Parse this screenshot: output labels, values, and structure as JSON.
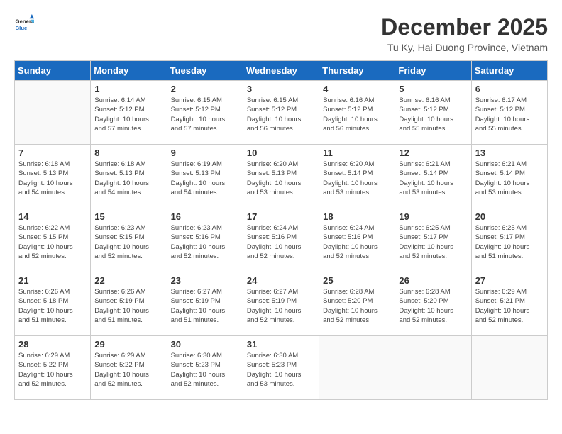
{
  "logo": {
    "line1": "General",
    "line2": "Blue"
  },
  "title": "December 2025",
  "subtitle": "Tu Ky, Hai Duong Province, Vietnam",
  "weekdays": [
    "Sunday",
    "Monday",
    "Tuesday",
    "Wednesday",
    "Thursday",
    "Friday",
    "Saturday"
  ],
  "weeks": [
    [
      {
        "day": "",
        "info": ""
      },
      {
        "day": "1",
        "info": "Sunrise: 6:14 AM\nSunset: 5:12 PM\nDaylight: 10 hours\nand 57 minutes."
      },
      {
        "day": "2",
        "info": "Sunrise: 6:15 AM\nSunset: 5:12 PM\nDaylight: 10 hours\nand 57 minutes."
      },
      {
        "day": "3",
        "info": "Sunrise: 6:15 AM\nSunset: 5:12 PM\nDaylight: 10 hours\nand 56 minutes."
      },
      {
        "day": "4",
        "info": "Sunrise: 6:16 AM\nSunset: 5:12 PM\nDaylight: 10 hours\nand 56 minutes."
      },
      {
        "day": "5",
        "info": "Sunrise: 6:16 AM\nSunset: 5:12 PM\nDaylight: 10 hours\nand 55 minutes."
      },
      {
        "day": "6",
        "info": "Sunrise: 6:17 AM\nSunset: 5:12 PM\nDaylight: 10 hours\nand 55 minutes."
      }
    ],
    [
      {
        "day": "7",
        "info": "Sunrise: 6:18 AM\nSunset: 5:13 PM\nDaylight: 10 hours\nand 54 minutes."
      },
      {
        "day": "8",
        "info": "Sunrise: 6:18 AM\nSunset: 5:13 PM\nDaylight: 10 hours\nand 54 minutes."
      },
      {
        "day": "9",
        "info": "Sunrise: 6:19 AM\nSunset: 5:13 PM\nDaylight: 10 hours\nand 54 minutes."
      },
      {
        "day": "10",
        "info": "Sunrise: 6:20 AM\nSunset: 5:13 PM\nDaylight: 10 hours\nand 53 minutes."
      },
      {
        "day": "11",
        "info": "Sunrise: 6:20 AM\nSunset: 5:14 PM\nDaylight: 10 hours\nand 53 minutes."
      },
      {
        "day": "12",
        "info": "Sunrise: 6:21 AM\nSunset: 5:14 PM\nDaylight: 10 hours\nand 53 minutes."
      },
      {
        "day": "13",
        "info": "Sunrise: 6:21 AM\nSunset: 5:14 PM\nDaylight: 10 hours\nand 53 minutes."
      }
    ],
    [
      {
        "day": "14",
        "info": "Sunrise: 6:22 AM\nSunset: 5:15 PM\nDaylight: 10 hours\nand 52 minutes."
      },
      {
        "day": "15",
        "info": "Sunrise: 6:23 AM\nSunset: 5:15 PM\nDaylight: 10 hours\nand 52 minutes."
      },
      {
        "day": "16",
        "info": "Sunrise: 6:23 AM\nSunset: 5:16 PM\nDaylight: 10 hours\nand 52 minutes."
      },
      {
        "day": "17",
        "info": "Sunrise: 6:24 AM\nSunset: 5:16 PM\nDaylight: 10 hours\nand 52 minutes."
      },
      {
        "day": "18",
        "info": "Sunrise: 6:24 AM\nSunset: 5:16 PM\nDaylight: 10 hours\nand 52 minutes."
      },
      {
        "day": "19",
        "info": "Sunrise: 6:25 AM\nSunset: 5:17 PM\nDaylight: 10 hours\nand 52 minutes."
      },
      {
        "day": "20",
        "info": "Sunrise: 6:25 AM\nSunset: 5:17 PM\nDaylight: 10 hours\nand 51 minutes."
      }
    ],
    [
      {
        "day": "21",
        "info": "Sunrise: 6:26 AM\nSunset: 5:18 PM\nDaylight: 10 hours\nand 51 minutes."
      },
      {
        "day": "22",
        "info": "Sunrise: 6:26 AM\nSunset: 5:19 PM\nDaylight: 10 hours\nand 51 minutes."
      },
      {
        "day": "23",
        "info": "Sunrise: 6:27 AM\nSunset: 5:19 PM\nDaylight: 10 hours\nand 51 minutes."
      },
      {
        "day": "24",
        "info": "Sunrise: 6:27 AM\nSunset: 5:19 PM\nDaylight: 10 hours\nand 52 minutes."
      },
      {
        "day": "25",
        "info": "Sunrise: 6:28 AM\nSunset: 5:20 PM\nDaylight: 10 hours\nand 52 minutes."
      },
      {
        "day": "26",
        "info": "Sunrise: 6:28 AM\nSunset: 5:20 PM\nDaylight: 10 hours\nand 52 minutes."
      },
      {
        "day": "27",
        "info": "Sunrise: 6:29 AM\nSunset: 5:21 PM\nDaylight: 10 hours\nand 52 minutes."
      }
    ],
    [
      {
        "day": "28",
        "info": "Sunrise: 6:29 AM\nSunset: 5:22 PM\nDaylight: 10 hours\nand 52 minutes."
      },
      {
        "day": "29",
        "info": "Sunrise: 6:29 AM\nSunset: 5:22 PM\nDaylight: 10 hours\nand 52 minutes."
      },
      {
        "day": "30",
        "info": "Sunrise: 6:30 AM\nSunset: 5:23 PM\nDaylight: 10 hours\nand 52 minutes."
      },
      {
        "day": "31",
        "info": "Sunrise: 6:30 AM\nSunset: 5:23 PM\nDaylight: 10 hours\nand 53 minutes."
      },
      {
        "day": "",
        "info": ""
      },
      {
        "day": "",
        "info": ""
      },
      {
        "day": "",
        "info": ""
      }
    ]
  ]
}
